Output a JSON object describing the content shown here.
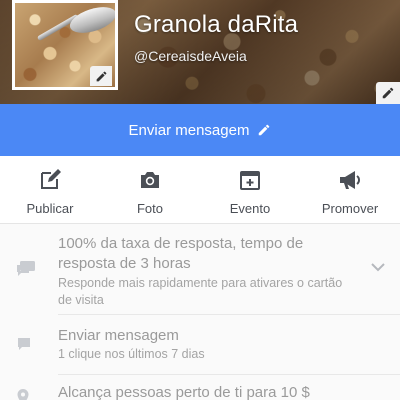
{
  "page": {
    "name": "Granola daRita",
    "handle": "@CereaisdeAveia"
  },
  "cta": {
    "label": "Enviar mensagem"
  },
  "actions": [
    {
      "label": "Publicar",
      "icon": "edit-square-icon"
    },
    {
      "label": "Foto",
      "icon": "camera-icon"
    },
    {
      "label": "Evento",
      "icon": "calendar-add-icon"
    },
    {
      "label": "Promover",
      "icon": "megaphone-icon"
    }
  ],
  "info": [
    {
      "title": "100% da taxa de resposta, tempo de resposta de 3 horas",
      "subtitle": "Responde mais rapidamente para ativares o cartão de visita",
      "icon": "chat-icon"
    },
    {
      "title": "Enviar mensagem",
      "subtitle": "1 clique nos últimos 7 dias",
      "icon": "message-icon"
    },
    {
      "title": "Alcança pessoas perto de ti para 10 $",
      "icon": "location-pin-icon"
    }
  ],
  "colors": {
    "primary": "#4b88f5",
    "icon_dark": "#4b4f56",
    "muted_text": "#9a9a9a"
  }
}
